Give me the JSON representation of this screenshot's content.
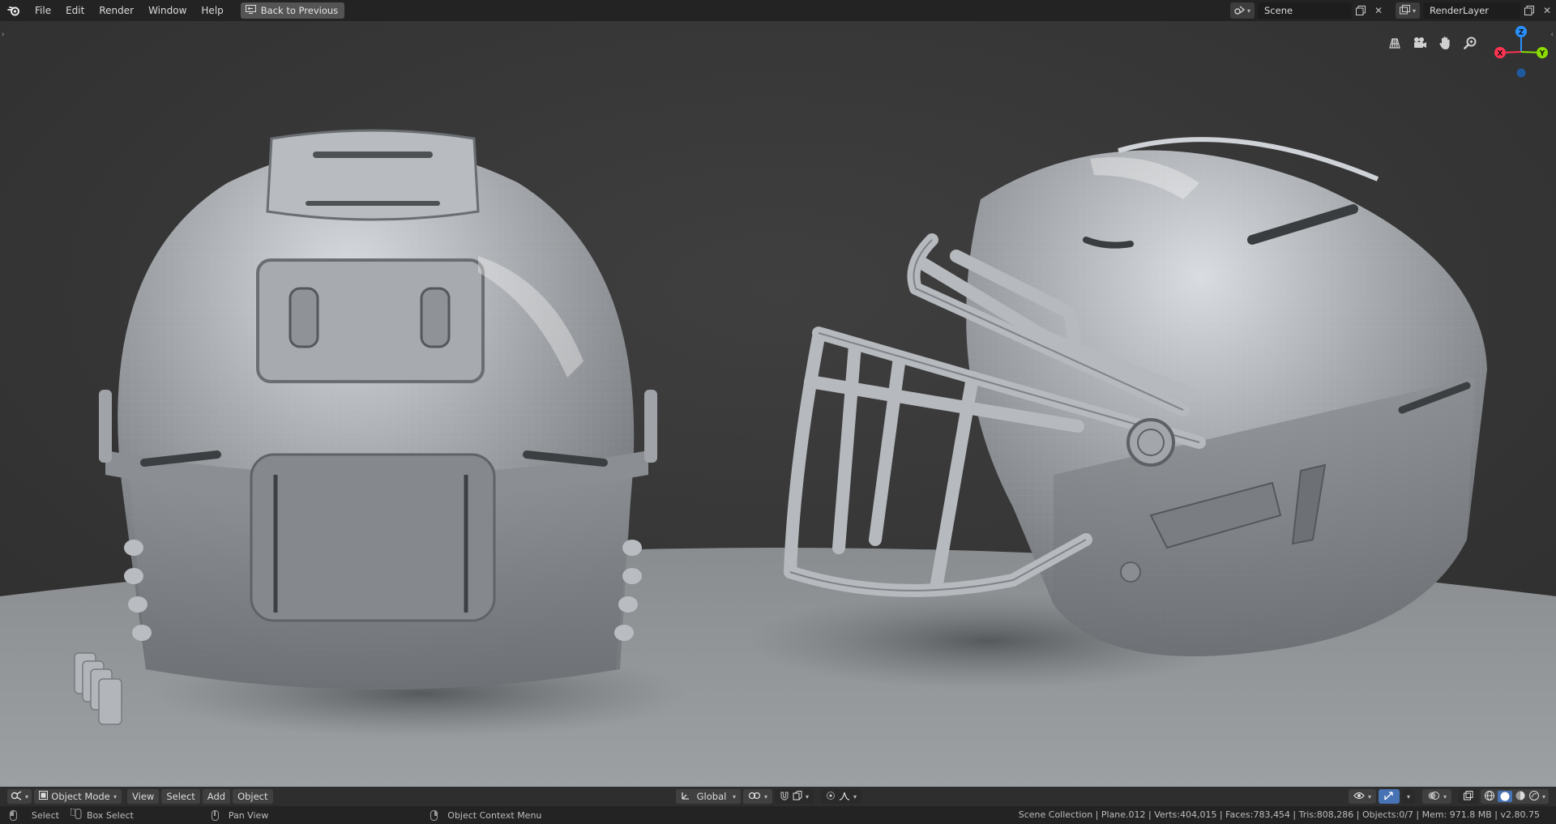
{
  "topbar": {
    "menus": [
      "File",
      "Edit",
      "Render",
      "Window",
      "Help"
    ],
    "back_label": "Back to Previous",
    "scene_name": "Scene",
    "layer_name": "RenderLayer"
  },
  "gizmo": {
    "x": "X",
    "y": "Y",
    "z": "Z"
  },
  "header": {
    "mode": "Object Mode",
    "menus": [
      "View",
      "Select",
      "Add",
      "Object"
    ],
    "orientation": "Global"
  },
  "status": {
    "select": "Select",
    "box_select": "Box Select",
    "pan_view": "Pan View",
    "context_menu": "Object Context Menu",
    "stats": "Scene Collection | Plane.012 | Verts:404,015 | Faces:783,454 | Tris:808,286 | Objects:0/7 | Mem: 971.8 MB | v2.80.75"
  },
  "colors": {
    "accent": "#4772b3",
    "axis_x": "#ff3352",
    "axis_y": "#8bdc00",
    "axis_z": "#2890ff"
  }
}
